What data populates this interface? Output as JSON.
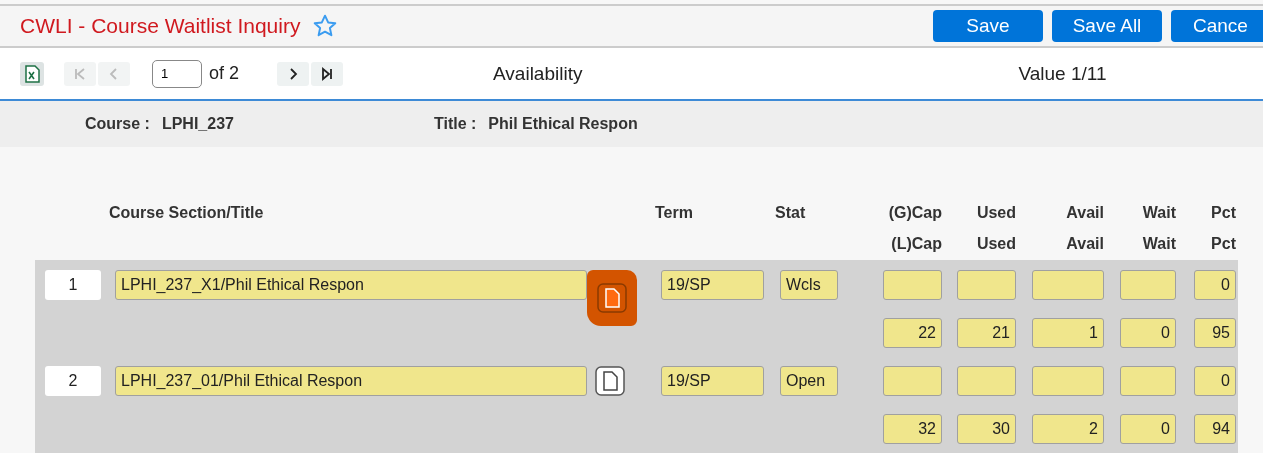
{
  "header": {
    "title": "CWLI - Course Waitlist Inquiry",
    "favorite": false,
    "buttons": [
      "Save",
      "Save All",
      "Cance"
    ]
  },
  "toolbar": {
    "page": "1",
    "page_count": "of 2",
    "first_disabled": true,
    "prev_disabled": true,
    "next_disabled": false,
    "last_disabled": false,
    "center_label": "Availability",
    "right_label": "Value 1/11"
  },
  "info": [
    {
      "label": "Course :",
      "value": "LPHI_237"
    },
    {
      "label": "Title :",
      "value": "Phil Ethical Respon"
    }
  ],
  "columns": {
    "section": "Course Section/Title",
    "term": "Term",
    "stat": "Stat",
    "numeric": [
      [
        "(G)Cap",
        "(L)Cap"
      ],
      [
        "Used",
        "Used"
      ],
      [
        "Avail",
        "Avail"
      ],
      [
        "Wait",
        "Wait"
      ],
      [
        "Pct",
        "Pct"
      ]
    ]
  },
  "sections": [
    {
      "number": "1",
      "title": "LPHI_237_X1/Phil Ethical Respon",
      "highlighted": true,
      "term": "19/SP",
      "stat": "Wcls",
      "global": {
        "pct": "0"
      },
      "local": {
        "cap": "22",
        "used": "21",
        "avail": "1",
        "wait": "0",
        "pct": "95"
      }
    },
    {
      "number": "2",
      "title": "LPHI_237_01/Phil Ethical Respon",
      "highlighted": false,
      "term": "19/SP",
      "stat": "Open",
      "global": {
        "pct": "0"
      },
      "local": {
        "cap": "32",
        "used": "30",
        "avail": "2",
        "wait": "0",
        "pct": "94"
      }
    }
  ]
}
